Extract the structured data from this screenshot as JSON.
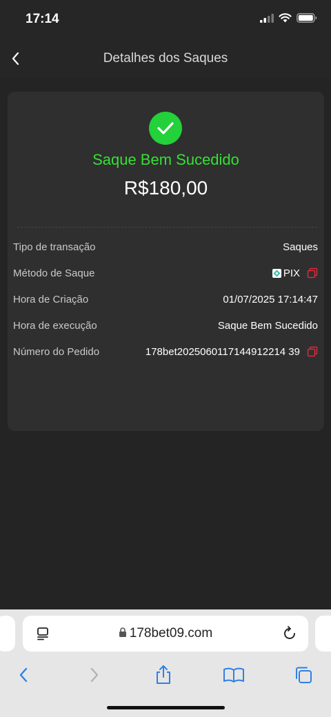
{
  "status_bar": {
    "time": "17:14"
  },
  "header": {
    "title": "Detalhes dos Saques"
  },
  "summary": {
    "status": "Saque Bem Sucedido",
    "amount": "R$180,00",
    "success_color": "#23d13a"
  },
  "details": [
    {
      "label": "Tipo de transação",
      "value": "Saques"
    },
    {
      "label": "Método de Saque",
      "value": "PIX"
    },
    {
      "label": "Hora de Criação",
      "value": "01/07/2025 17:14:47"
    },
    {
      "label": "Hora de execução",
      "value": "Saque Bem Sucedido"
    },
    {
      "label": "Número do Pedido",
      "value": "178bet2025060117144912214 39"
    }
  ],
  "browser": {
    "url": "178bet09.com"
  },
  "icons": {
    "back": "chevron-left-icon",
    "check": "checkmark-icon",
    "copy": "copy-icon",
    "pix": "pix-logo-icon",
    "tabs": "tab-overview-icon",
    "lock": "lock-icon",
    "reload": "reload-icon",
    "share": "share-icon",
    "bookmarks": "book-icon",
    "tabs_grid": "tabs-icon"
  },
  "colors": {
    "accent_copy": "#e0283a",
    "ios_blue": "#2f7fe6"
  }
}
